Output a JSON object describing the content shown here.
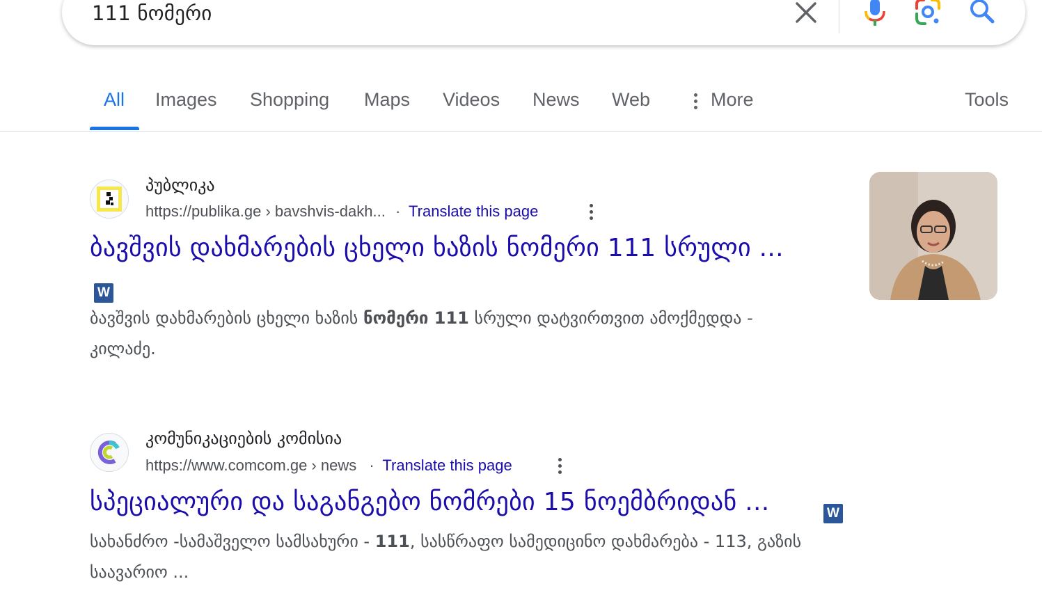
{
  "search": {
    "query": "111 ნომერი",
    "clear_icon": "close-icon",
    "mic_icon": "microphone-icon",
    "lens_icon": "google-lens-icon",
    "search_icon": "search-icon"
  },
  "tabs": {
    "all": "All",
    "images": "Images",
    "shopping": "Shopping",
    "maps": "Maps",
    "videos": "Videos",
    "news": "News",
    "web": "Web",
    "more": "More",
    "tools": "Tools"
  },
  "results": [
    {
      "site_name": "პუბლიკა",
      "url": "https://publika.ge › bavshvis-dakh...",
      "separator": "·",
      "translate": "Translate this page",
      "title": "ბავშვის დახმარების ცხელი ხაზის ნომერი 111 სრული ...",
      "badge": "W",
      "snippet_before": "ბავშვის დახმარების ცხელი ხაზის ",
      "snippet_bold": "ნომერი 111",
      "snippet_after": " სრული დატვირთვით ამოქმედდა -",
      "snippet_line2": "კილაძე."
    },
    {
      "site_name": "კომუნიკაციების კომისია",
      "url": "https://www.comcom.ge › news",
      "separator": "·",
      "translate": "Translate this page",
      "title": "სპეციალური და საგანგებო ნომრები 15 ნოემბრიდან ...",
      "badge": "W",
      "snippet_before": "სახანძრო -სამაშველო სამსახური - ",
      "snippet_bold": "111",
      "snippet_after": ", სასწრაფო სამედიცინო დახმარება - 113, გაზის",
      "snippet_line2": "საავარიო ..."
    }
  ],
  "colors": {
    "link": "#1a0dab",
    "accent": "#1a73e8",
    "text": "#202124",
    "muted": "#4d5156"
  }
}
